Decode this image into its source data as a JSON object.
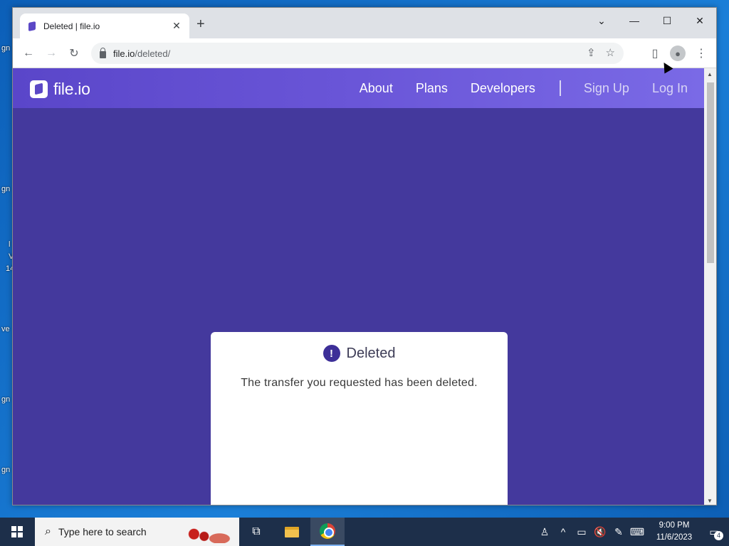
{
  "desktop": {
    "labels": [
      "gn",
      "gn",
      "l",
      "V",
      "14",
      "ve",
      "gn",
      "gn"
    ]
  },
  "browser": {
    "tab_title": "Deleted | file.io",
    "url_host": "file.io",
    "url_path": "/deleted/"
  },
  "site": {
    "logo_text": "file.io",
    "nav": [
      "About",
      "Plans",
      "Developers"
    ],
    "auth": [
      "Sign Up",
      "Log In"
    ]
  },
  "card": {
    "title": "Deleted",
    "message": "The transfer you requested has been deleted."
  },
  "taskbar": {
    "search_placeholder": "Type here to search",
    "time": "9:00 PM",
    "date": "11/6/2023",
    "notification_count": "4"
  }
}
